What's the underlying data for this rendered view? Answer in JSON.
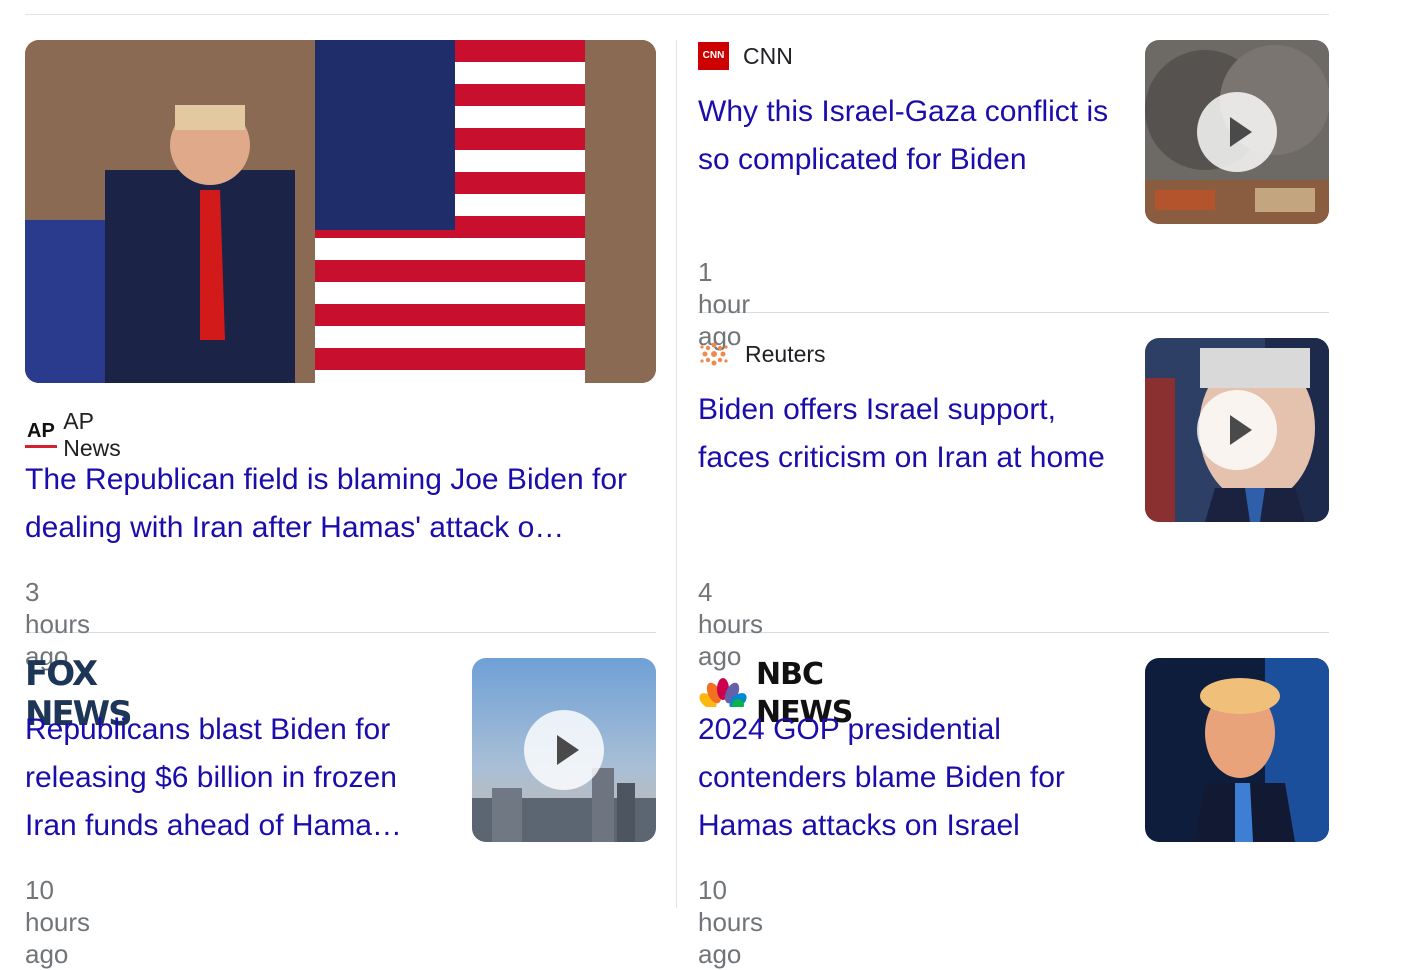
{
  "cards": [
    {
      "source": "AP News",
      "logo_text": "AP",
      "headline": "The Republican field is blaming Joe Biden for dealing with Iran after Hamas' attack o…",
      "time": "3 hours ago",
      "has_video": false
    },
    {
      "source": "CNN",
      "logo_text": "CNN",
      "headline": "Why this Israel-Gaza conflict is so complicated for Biden",
      "time": "1 hour ago",
      "has_video": true
    },
    {
      "source": "Reuters",
      "headline": "Biden offers Israel support, faces criticism on Iran at home",
      "time": "4 hours ago",
      "has_video": true
    },
    {
      "source": "FOX NEWS",
      "headline": "Republicans blast Biden for releasing $6 billion in frozen Iran funds ahead of Hama…",
      "time": "10 hours ago",
      "has_video": true
    },
    {
      "source": "NBC NEWS",
      "headline": "2024 GOP presidential contenders blame Biden for Hamas attacks on Israel",
      "time": "10 hours ago",
      "has_video": false
    }
  ],
  "colors": {
    "headline": "#1a0dab",
    "time": "#70757a",
    "cnn_red": "#cc0000",
    "fox_navy": "#1d3557"
  },
  "icons": [
    "ap-logo-icon",
    "cnn-logo-icon",
    "reuters-logo-icon",
    "fox-news-logo-icon",
    "nbc-peacock-icon",
    "play-icon"
  ]
}
